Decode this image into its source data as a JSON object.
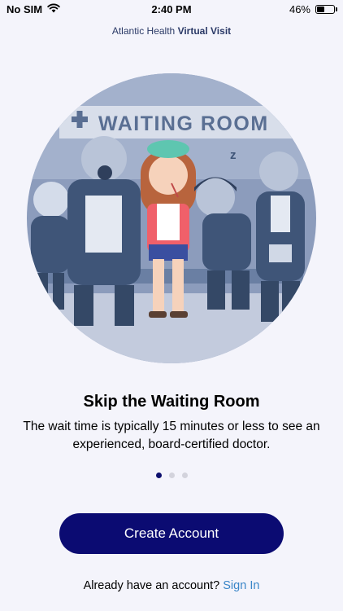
{
  "status_bar": {
    "carrier": "No SIM",
    "time": "2:40 PM",
    "battery_percent": "46%",
    "battery_level": 0.46,
    "icons": [
      "wifi-icon",
      "battery-icon"
    ]
  },
  "brand": {
    "name_regular": "Atlantic Health",
    "name_strong": "Virtual Visit",
    "color": "#2b3a67"
  },
  "illustration": {
    "sign_text": "WAITING ROOM",
    "sleep_text": "z",
    "colors": {
      "circle_bg": "#7d8fb0",
      "figure_blue": "#3f5578",
      "accent_pink": "#f0606a",
      "accent_teal": "#5ec6b0"
    }
  },
  "onboarding": {
    "title": "Skip the Waiting Room",
    "description": "The wait time is typically 15 minutes or less to see an experienced, board-certified doctor.",
    "page_count": 3,
    "active_page": 0
  },
  "actions": {
    "create_account": "Create Account",
    "signin_prompt": "Already have an account?",
    "signin_link": "Sign In"
  },
  "colors": {
    "primary": "#0b0b72",
    "link": "#3a86c8",
    "background": "#f4f4fb"
  }
}
